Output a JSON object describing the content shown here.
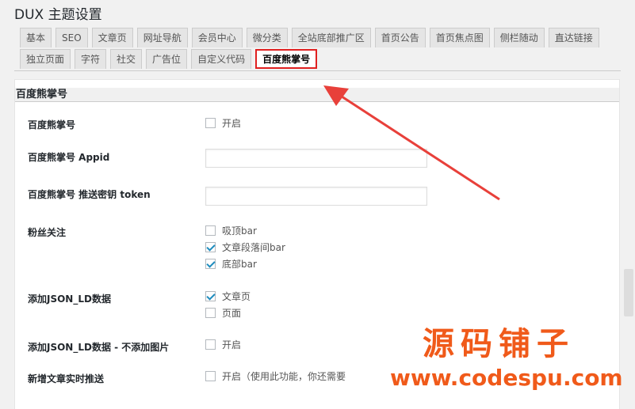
{
  "page": {
    "title": "DUX 主题设置"
  },
  "tabs": {
    "row1": [
      "基本",
      "SEO",
      "文章页",
      "网址导航",
      "会员中心",
      "微分类",
      "全站底部推广区",
      "首页公告",
      "首页焦点图",
      "侧栏随动",
      "直达链接"
    ],
    "row2": [
      "独立页面",
      "字符",
      "社交",
      "广告位",
      "自定义代码",
      "百度熊掌号"
    ],
    "active": "百度熊掌号"
  },
  "section": {
    "title": "百度熊掌号"
  },
  "fields": {
    "enable": {
      "label": "百度熊掌号",
      "option": "开启"
    },
    "appid": {
      "label": "百度熊掌号 Appid",
      "value": ""
    },
    "token": {
      "label": "百度熊掌号 推送密钥 token",
      "value": ""
    },
    "fans": {
      "label": "粉丝关注",
      "options": [
        {
          "text": "吸顶bar",
          "checked": false
        },
        {
          "text": "文章段落间bar",
          "checked": true
        },
        {
          "text": "底部bar",
          "checked": true
        }
      ]
    },
    "jsonld": {
      "label": "添加JSON_LD数据",
      "options": [
        {
          "text": "文章页",
          "checked": true
        },
        {
          "text": "页面",
          "checked": false
        }
      ]
    },
    "jsonld_noimg": {
      "label": "添加JSON_LD数据 - 不添加图片",
      "option": "开启"
    },
    "realtime": {
      "label": "新增文章实时推送",
      "option": "开启（使用此功能，你还需要"
    }
  },
  "watermark": {
    "line1": "源码铺子",
    "line2": "www.codespu.com"
  },
  "colors": {
    "accent": "#e02020",
    "checkbox": "#1e8cbe",
    "watermark": "#f05a1a"
  }
}
